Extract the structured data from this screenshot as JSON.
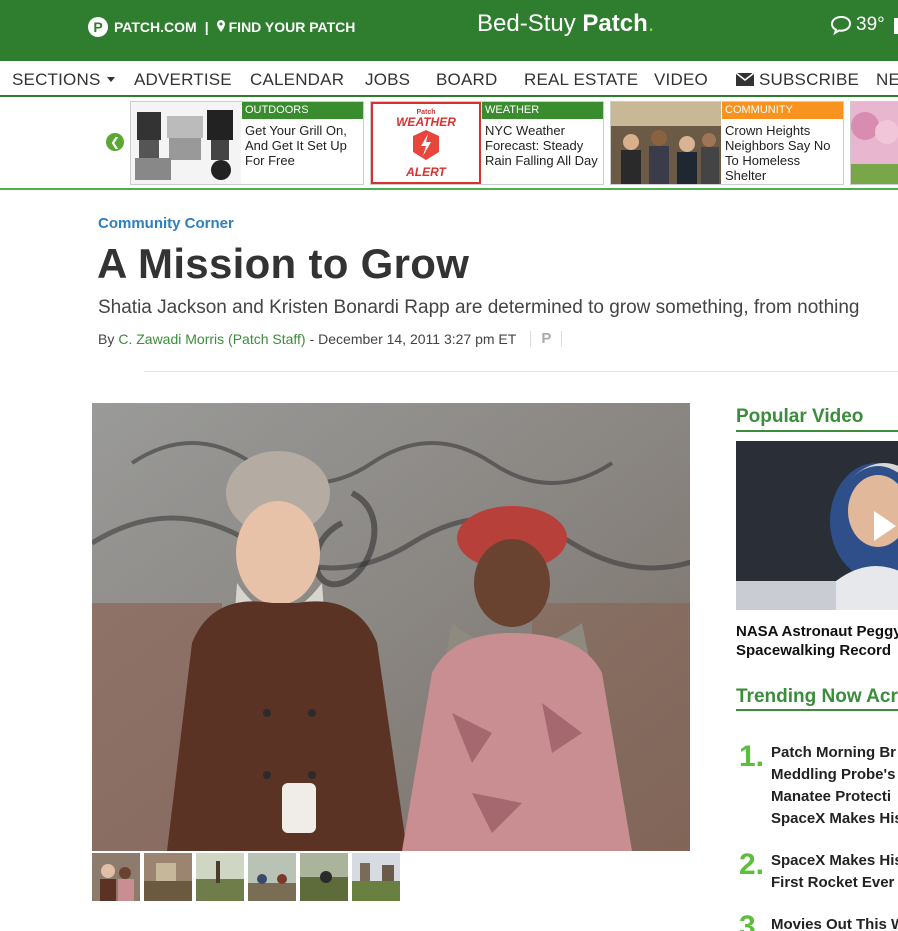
{
  "topbar": {
    "logo_letter": "P",
    "site_link": "PATCH.COM",
    "separator": "|",
    "find_patch": "FIND YOUR PATCH",
    "brand_prefix": "Bed-Stuy",
    "brand_name": "Patch",
    "temperature": "39°",
    "bg_color": "#2f7d2f"
  },
  "nav": {
    "items": [
      "SECTIONS",
      "ADVERTISE",
      "CALENDAR",
      "JOBS",
      "BOARD",
      "REAL ESTATE",
      "VIDEO",
      "SUBSCRIBE",
      "NE"
    ]
  },
  "carousel": {
    "cards": [
      {
        "category": "OUTDOORS",
        "category_color": "#3a8d2e",
        "title": "Get Your Grill On, And Get It Set Up For Free",
        "thumb": "grill-image"
      },
      {
        "category": "WEATHER",
        "category_color": "#3a8d2e",
        "title": "NYC Weather Forecast: Steady Rain Falling All Day",
        "thumb": "weather-alert-image",
        "alert_top": "Patch",
        "alert_word1": "WEATHER",
        "alert_word2": "ALERT"
      },
      {
        "category": "COMMUNITY",
        "category_color": "#f7931e",
        "title": "Crown Heights Neighbors Say No To Homeless Shelter",
        "thumb": "community-meeting-image"
      }
    ]
  },
  "article": {
    "section": "Community Corner",
    "headline": "A Mission to Grow",
    "dek": "Shatia Jackson and Kristen Bonardi Rapp are determined to grow something, from nothing",
    "by": "By",
    "author": "C. Zawadi Morris (Patch Staff)",
    "date": "- December 14, 2011 3:27 pm ET",
    "patch_mark": "P",
    "thumbnail_count": 6
  },
  "sidebar": {
    "popular_video_heading": "Popular Video",
    "video_caption_line1": "NASA Astronaut Peggy",
    "video_caption_line2": "Spacewalking Record",
    "trending_heading": "Trending Now Acro",
    "trending": [
      {
        "num": "1.",
        "lines": [
          "Patch Morning Br",
          "Meddling Probe's",
          "Manatee Protecti",
          "SpaceX Makes His"
        ]
      },
      {
        "num": "2.",
        "lines": [
          "SpaceX Makes His",
          "First Rocket Ever U"
        ]
      },
      {
        "num": "3",
        "lines": [
          "Movies Out This W"
        ]
      }
    ]
  }
}
